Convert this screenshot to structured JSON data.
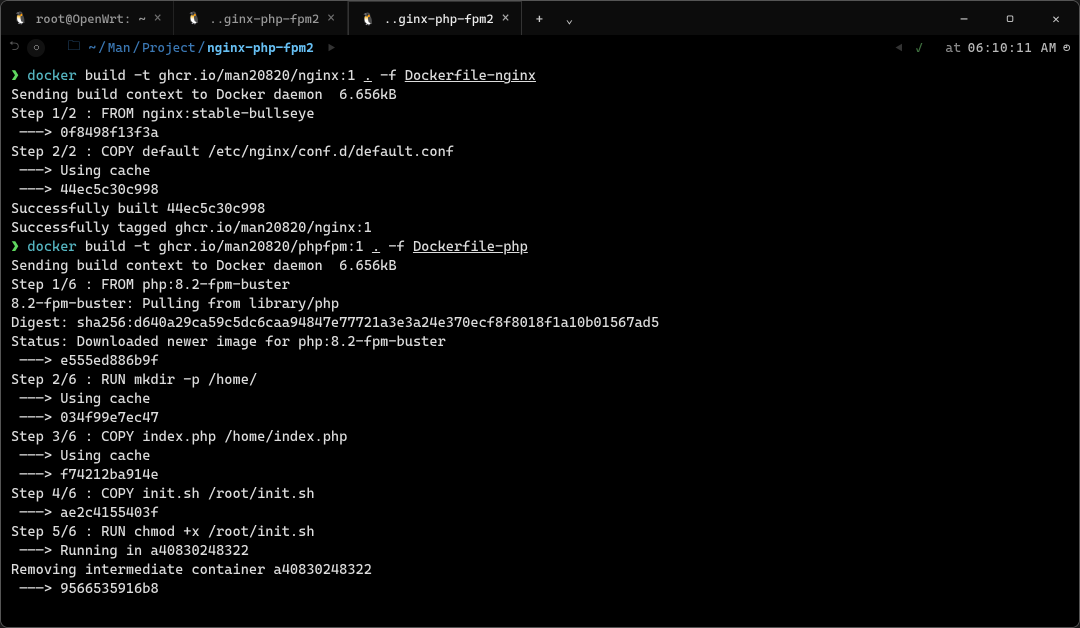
{
  "tabs": [
    {
      "icon": "tux-icon",
      "title": "root@OpenWrt: ~",
      "active": false
    },
    {
      "icon": "tux-icon",
      "title": "..ginx-php-fpm2",
      "active": false
    },
    {
      "icon": "tux-icon",
      "title": "..ginx-php-fpm2",
      "active": true
    }
  ],
  "statusbar": {
    "path_segments": [
      "~",
      "Man",
      "Project",
      "nginx-php-fpm2"
    ],
    "time_label": "at",
    "time_value": "06:10:11 AM"
  },
  "lines": [
    {
      "type": "cmd",
      "prompt": "❯",
      "parts": [
        {
          "cls": "cy",
          "t": "docker"
        },
        {
          "cls": "wh",
          "t": " build -t ghcr.io/man20820/nginx:1 "
        },
        {
          "cls": "wh ul",
          "t": "."
        },
        {
          "cls": "wh",
          "t": " -f "
        },
        {
          "cls": "wh ul",
          "t": "Dockerfile-nginx"
        }
      ]
    },
    {
      "type": "out",
      "t": "Sending build context to Docker daemon  6.656kB"
    },
    {
      "type": "out",
      "t": "Step 1/2 : FROM nginx:stable-bullseye"
    },
    {
      "type": "arrow",
      "t": "0f8498f13f3a"
    },
    {
      "type": "out",
      "t": "Step 2/2 : COPY default /etc/nginx/conf.d/default.conf"
    },
    {
      "type": "arrow",
      "t": "Using cache"
    },
    {
      "type": "arrow",
      "t": "44ec5c30c998"
    },
    {
      "type": "out",
      "t": "Successfully built 44ec5c30c998"
    },
    {
      "type": "out",
      "t": "Successfully tagged ghcr.io/man20820/nginx:1"
    },
    {
      "type": "cmd",
      "prompt": "❯",
      "parts": [
        {
          "cls": "cy",
          "t": "docker"
        },
        {
          "cls": "wh",
          "t": " build -t ghcr.io/man20820/phpfpm:1 "
        },
        {
          "cls": "wh ul",
          "t": "."
        },
        {
          "cls": "wh",
          "t": " -f "
        },
        {
          "cls": "wh ul",
          "t": "Dockerfile-php"
        }
      ]
    },
    {
      "type": "out",
      "t": "Sending build context to Docker daemon  6.656kB"
    },
    {
      "type": "out",
      "t": "Step 1/6 : FROM php:8.2-fpm-buster"
    },
    {
      "type": "out",
      "t": "8.2-fpm-buster: Pulling from library/php"
    },
    {
      "type": "out",
      "t": "Digest: sha256:d640a29ca59c5dc6caa94847e77721a3e3a24e370ecf8f8018f1a10b01567ad5"
    },
    {
      "type": "out",
      "t": "Status: Downloaded newer image for php:8.2-fpm-buster"
    },
    {
      "type": "arrow",
      "t": "e555ed886b9f"
    },
    {
      "type": "out",
      "t": "Step 2/6 : RUN mkdir -p /home/"
    },
    {
      "type": "arrow",
      "t": "Using cache"
    },
    {
      "type": "arrow",
      "t": "034f99e7ec47"
    },
    {
      "type": "out",
      "t": "Step 3/6 : COPY index.php /home/index.php"
    },
    {
      "type": "arrow",
      "t": "Using cache"
    },
    {
      "type": "arrow",
      "t": "f74212ba914e"
    },
    {
      "type": "out",
      "t": "Step 4/6 : COPY init.sh /root/init.sh"
    },
    {
      "type": "arrow",
      "t": "ae2c4155403f"
    },
    {
      "type": "out",
      "t": "Step 5/6 : RUN chmod +x /root/init.sh"
    },
    {
      "type": "arrow",
      "t": "Running in a40830248322"
    },
    {
      "type": "out",
      "t": "Removing intermediate container a40830248322"
    },
    {
      "type": "arrow",
      "t": "9566535916b8"
    }
  ],
  "win": {
    "minimize": "—",
    "maximize": "▢",
    "close": "✕",
    "newtab": "+",
    "dropdown": "⌄"
  }
}
